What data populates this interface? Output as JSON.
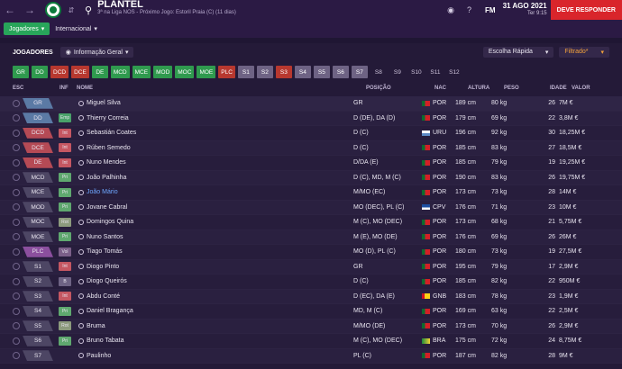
{
  "topbar": {
    "title": "PLANTEL",
    "subtitle": "3ª na Liga NOS - Próximo Jogo: Estoril Praia (C) (11 dias)",
    "date": "31 AGO 2021",
    "time": "Ter 9:15",
    "fm_label": "FM",
    "must_respond": "DEVE RESPONDER"
  },
  "subnav": {
    "tabs": [
      "Jogadores",
      "Internacional"
    ]
  },
  "toolbar": {
    "title": "JOGADORES",
    "view": "Informação Geral",
    "quick_pick": "Escolha Rápida",
    "filter": "Filtrado*"
  },
  "positions": [
    "GR",
    "DD",
    "DCD",
    "DCE",
    "DE",
    "MCD",
    "MCE",
    "MOD",
    "MOC",
    "MOE",
    "PLC",
    "S1",
    "S2",
    "S3",
    "S4",
    "S5",
    "S6",
    "S7",
    "S8",
    "S9",
    "S10",
    "S11",
    "S12"
  ],
  "columns": {
    "esc": "ESC",
    "inf": "INF",
    "name": "NOME",
    "position": "POSIÇÃO",
    "nat": "NAC",
    "height": "ALTURA",
    "weight": "PESO",
    "age": "IDADE",
    "value": "VALOR"
  },
  "players": [
    {
      "tag": "GR",
      "inf": "",
      "name": "Miguel Silva",
      "position": "GR",
      "nat": "POR",
      "height": "189 cm",
      "weight": "80 kg",
      "age": "26",
      "value": "7M €"
    },
    {
      "tag": "DD",
      "inf": "Emp",
      "name": "Thierry Correia",
      "position": "D (DE), DA (D)",
      "nat": "POR",
      "height": "179 cm",
      "weight": "69 kg",
      "age": "22",
      "value": "3,8M €"
    },
    {
      "tag": "DCD",
      "inf": "Int",
      "name": "Sebastián Coates",
      "position": "D (C)",
      "nat": "URU",
      "height": "196 cm",
      "weight": "92 kg",
      "age": "30",
      "value": "18,25M €"
    },
    {
      "tag": "DCE",
      "inf": "Int",
      "name": "Rúben Semedo",
      "position": "D (C)",
      "nat": "POR",
      "height": "185 cm",
      "weight": "83 kg",
      "age": "27",
      "value": "18,5M €"
    },
    {
      "tag": "DE",
      "inf": "Int",
      "name": "Nuno Mendes",
      "position": "D/DA (E)",
      "nat": "POR",
      "height": "185 cm",
      "weight": "79 kg",
      "age": "19",
      "value": "19,25M €"
    },
    {
      "tag": "MCD",
      "inf": "Pri",
      "name": "João Palhinha",
      "position": "D (C), MD, M (C)",
      "nat": "POR",
      "height": "190 cm",
      "weight": "83 kg",
      "age": "26",
      "value": "19,75M €"
    },
    {
      "tag": "MCE",
      "inf": "Pri",
      "name": "João Mário",
      "position": "M/MO (EC)",
      "nat": "POR",
      "height": "173 cm",
      "weight": "73 kg",
      "age": "28",
      "value": "14M €"
    },
    {
      "tag": "MOD",
      "inf": "Pri",
      "name": "Jovane Cabral",
      "position": "MO (DEC), PL (C)",
      "nat": "CPV",
      "height": "176 cm",
      "weight": "71 kg",
      "age": "23",
      "value": "10M €"
    },
    {
      "tag": "MOC",
      "inf": "Rot",
      "name": "Domingos Quina",
      "position": "M (C), MO (DEC)",
      "nat": "POR",
      "height": "173 cm",
      "weight": "68 kg",
      "age": "21",
      "value": "5,75M €"
    },
    {
      "tag": "MOE",
      "inf": "Pri",
      "name": "Nuno Santos",
      "position": "M (E), MO (DE)",
      "nat": "POR",
      "height": "176 cm",
      "weight": "69 kg",
      "age": "26",
      "value": "26M €"
    },
    {
      "tag": "PLC",
      "inf": "Vol",
      "name": "Tiago Tomás",
      "position": "MO (D), PL (C)",
      "nat": "POR",
      "height": "180 cm",
      "weight": "73 kg",
      "age": "19",
      "value": "27,5M €"
    },
    {
      "tag": "S1",
      "inf": "Int",
      "name": "Diogo Pinto",
      "position": "GR",
      "nat": "POR",
      "height": "195 cm",
      "weight": "79 kg",
      "age": "17",
      "value": "2,9M €"
    },
    {
      "tag": "S2",
      "inf": "B",
      "name": "Diogo Queirós",
      "position": "D (C)",
      "nat": "POR",
      "height": "185 cm",
      "weight": "82 kg",
      "age": "22",
      "value": "950M €"
    },
    {
      "tag": "S3",
      "inf": "Int",
      "name": "Abdu Conté",
      "position": "D (EC), DA (E)",
      "nat": "GNB",
      "height": "183 cm",
      "weight": "78 kg",
      "age": "23",
      "value": "1,9M €"
    },
    {
      "tag": "S4",
      "inf": "Pri",
      "name": "Daniel Bragança",
      "position": "MD, M (C)",
      "nat": "POR",
      "height": "169 cm",
      "weight": "63 kg",
      "age": "22",
      "value": "2,5M €"
    },
    {
      "tag": "S5",
      "inf": "Rot",
      "name": "Bruma",
      "position": "M/MO (DE)",
      "nat": "POR",
      "height": "173 cm",
      "weight": "70 kg",
      "age": "26",
      "value": "2,9M €"
    },
    {
      "tag": "S6",
      "inf": "Pri",
      "name": "Bruno Tabata",
      "position": "M (C), MO (DEC)",
      "nat": "BRA",
      "height": "175 cm",
      "weight": "72 kg",
      "age": "24",
      "value": "8,75M €"
    },
    {
      "tag": "S7",
      "inf": "",
      "name": "Paulinho",
      "position": "PL (C)",
      "nat": "POR",
      "height": "187 cm",
      "weight": "82 kg",
      "age": "28",
      "value": "9M €"
    }
  ]
}
